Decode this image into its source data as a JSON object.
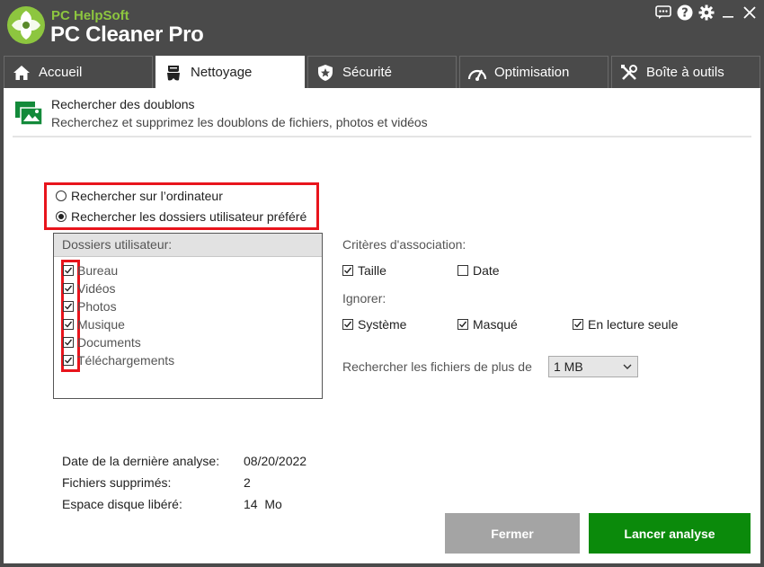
{
  "app": {
    "brand_top": "PC HelpSoft",
    "brand_main": "PC Cleaner Pro",
    "colors": {
      "frame": "#4a4a4a",
      "brand_green": "#8dc63f",
      "scan_button": "#0b8a0b",
      "close_button": "#a4a4a4",
      "highlight": "#e8141c"
    }
  },
  "titlebar_icons": [
    "chat-icon",
    "help-icon",
    "gear-icon",
    "minimize-icon",
    "close-icon"
  ],
  "tabs": [
    {
      "label": "Accueil",
      "icon": "home-icon",
      "active": false
    },
    {
      "label": "Nettoyage",
      "icon": "broom-icon",
      "active": true
    },
    {
      "label": "Sécurité",
      "icon": "shield-icon",
      "active": false
    },
    {
      "label": "Optimisation",
      "icon": "speedometer-icon",
      "active": false
    },
    {
      "label": "Boîte à outils",
      "icon": "tools-icon",
      "active": false
    }
  ],
  "header": {
    "title": "Rechercher des doublons",
    "subtitle": "Recherchez et supprimez les doublons de fichiers, photos et vidéos"
  },
  "search_scope": {
    "options": [
      {
        "label": "Rechercher sur l’ordinateur",
        "selected": false
      },
      {
        "label": "Rechercher les dossiers utilisateur préféré",
        "selected": true
      }
    ]
  },
  "folders": {
    "header": "Dossiers utilisateur:",
    "items": [
      {
        "label": "Bureau",
        "checked": true
      },
      {
        "label": "Vidéos",
        "checked": true
      },
      {
        "label": "Photos",
        "checked": true
      },
      {
        "label": "Musique",
        "checked": true
      },
      {
        "label": "Documents",
        "checked": true
      },
      {
        "label": "Téléchargements",
        "checked": true
      }
    ]
  },
  "criteria": {
    "label": "Critères d'association:",
    "size_label": "Taille",
    "size_checked": true,
    "date_label": "Date",
    "date_checked": false
  },
  "ignore": {
    "label": "Ignorer:",
    "system_label": "Système",
    "system_checked": true,
    "hidden_label": "Masqué",
    "hidden_checked": true,
    "readonly_label": "En lecture seule",
    "readonly_checked": true
  },
  "min_size": {
    "label": "Rechercher les fichiers de plus de",
    "value": "1 MB"
  },
  "stats": {
    "last_scan_label": "Date de la dernière analyse:",
    "last_scan_value": "08/20/2022",
    "deleted_label": "Fichiers supprimés:",
    "deleted_value": "2",
    "freed_label": "Espace disque libéré:",
    "freed_value": "14  Mo"
  },
  "buttons": {
    "close_label": "Fermer",
    "scan_label": "Lancer analyse"
  }
}
